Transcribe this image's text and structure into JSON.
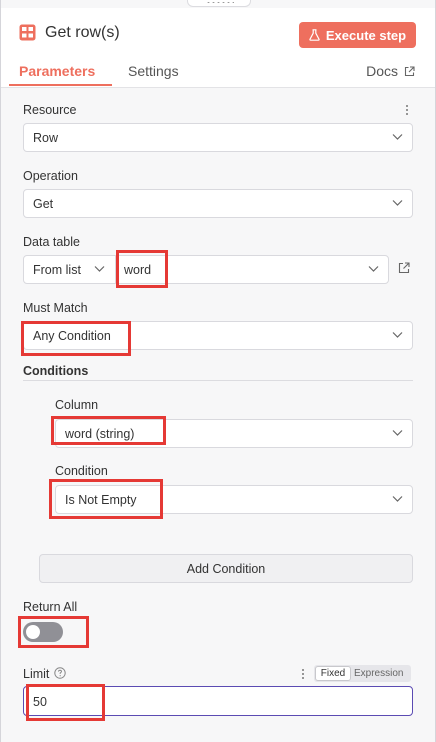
{
  "header": {
    "title": "Get row(s)",
    "execute_label": "Execute step"
  },
  "tabs": [
    {
      "label": "Parameters",
      "active": true
    },
    {
      "label": "Settings",
      "active": false
    }
  ],
  "docs_label": "Docs",
  "fields": {
    "resource": {
      "label": "Resource",
      "value": "Row"
    },
    "operation": {
      "label": "Operation",
      "value": "Get"
    },
    "data_table": {
      "label": "Data table",
      "mode": "From list",
      "value": "word"
    },
    "must_match": {
      "label": "Must Match",
      "value": "Any Condition"
    },
    "conditions": {
      "label": "Conditions",
      "column": {
        "label": "Column",
        "value": "word (string)"
      },
      "condition": {
        "label": "Condition",
        "value": "Is Not Empty"
      },
      "add_label": "Add Condition"
    },
    "return_all": {
      "label": "Return All",
      "enabled": false
    },
    "limit": {
      "label": "Limit",
      "value": "50",
      "mode_fixed": "Fixed",
      "mode_expression": "Expression"
    }
  },
  "colors": {
    "accent": "#ee6f5e",
    "highlight": "#e53935",
    "focus_border": "#5b4bb3"
  },
  "icons": {
    "title": "table-icon",
    "execute": "flask-icon",
    "docs": "external-link-icon",
    "data_table_link": "external-link-icon",
    "resource_options": "more-vertical-icon",
    "limit_options": "more-vertical-icon",
    "limit_help": "help-circle-icon",
    "dropdown": "chevron-down-icon"
  }
}
